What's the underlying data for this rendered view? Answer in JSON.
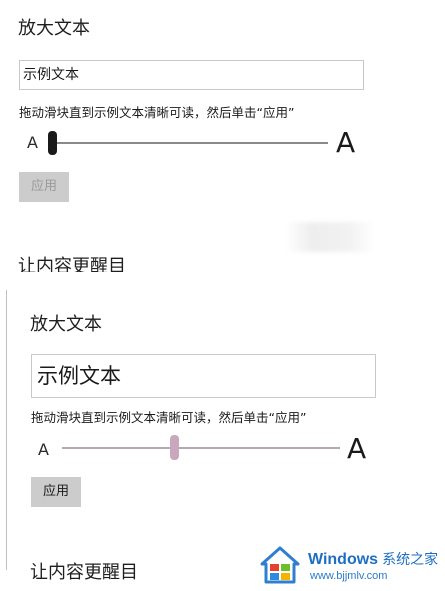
{
  "top_panel": {
    "section_title": "放大文本",
    "sample_text": "示例文本",
    "instruction": "拖动滑块直到示例文本清晰可读，然后单击“应用”",
    "slider_min_label": "A",
    "slider_max_label": "A",
    "slider_value_percent": 0,
    "apply_label": "应用",
    "apply_enabled": false,
    "next_section_title": "让内容更醒目"
  },
  "bottom_panel": {
    "section_title": "放大文本",
    "sample_text": "示例文本",
    "instruction": "拖动滑块直到示例文本清晰可读，然后单击“应用”",
    "slider_min_label": "A",
    "slider_max_label": "A",
    "slider_value_percent": 40,
    "apply_label": "应用",
    "apply_enabled": true,
    "next_section_title": "让内容更醒目"
  },
  "watermark": {
    "brand": "Windows",
    "brand_cn": "系统之家",
    "url": "www.bjjmlv.com",
    "logo_icon": "windows-logo-icon"
  },
  "colors": {
    "slider_thumb_default": "#1a1a1a",
    "slider_thumb_active": "#c9a8bd",
    "button_bg": "#cccccc",
    "watermark_blue": "#1e6fc2"
  }
}
